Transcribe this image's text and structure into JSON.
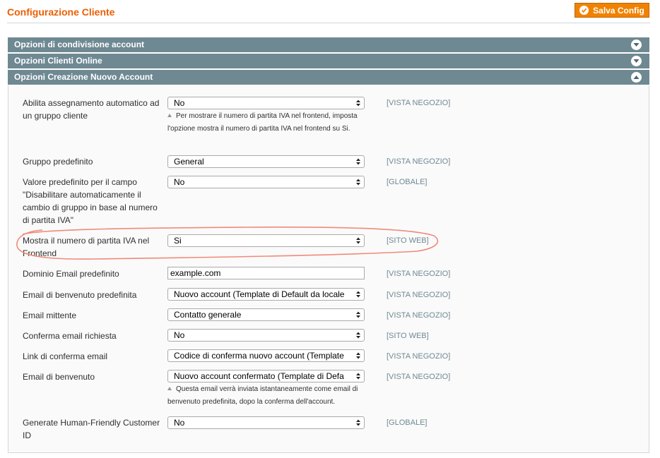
{
  "header": {
    "title": "Configurazione Cliente",
    "save_label": "Salva Config"
  },
  "sections": [
    {
      "label": "Opzioni di condivisione account",
      "state": "collapsed"
    },
    {
      "label": "Opzioni Clienti Online",
      "state": "collapsed"
    },
    {
      "label": "Opzioni Creazione Nuovo Account",
      "state": "expanded"
    }
  ],
  "fields": [
    {
      "label": "Abilita assegnamento automatico ad un gruppo cliente",
      "value": "No",
      "scope": "[VISTA NEGOZIO]",
      "note": "Per mostrare il numero di partita IVA nel frontend, imposta l'opzione mostra il numero di partita IVA nel frontend su Si."
    },
    {
      "label": "Gruppo predefinito",
      "value": "General",
      "scope": "[VISTA NEGOZIO]"
    },
    {
      "label": "Valore predefinito per il campo \"Disabilitare automaticamente il cambio di gruppo in base al numero di partita IVA\"",
      "value": "No",
      "scope": "[GLOBALE]"
    },
    {
      "label": "Mostra il numero di partita IVA nel Frontend",
      "value": "Si",
      "scope": "[SITO WEB]"
    },
    {
      "label": "Dominio Email predefinito",
      "value": "example.com",
      "scope": "[VISTA NEGOZIO]"
    },
    {
      "label": "Email di benvenuto predefinita",
      "value": "Nuovo account (Template di Default da locale",
      "scope": "[VISTA NEGOZIO]"
    },
    {
      "label": "Email mittente",
      "value": "Contatto generale",
      "scope": "[VISTA NEGOZIO]"
    },
    {
      "label": "Conferma email richiesta",
      "value": "No",
      "scope": "[SITO WEB]"
    },
    {
      "label": "Link di conferma email",
      "value": "Codice di conferma nuovo account (Template",
      "scope": "[VISTA NEGOZIO]"
    },
    {
      "label": "Email di benvenuto",
      "value": "Nuovo account confermato (Template di Defa",
      "scope": "[VISTA NEGOZIO]",
      "note": "Questa email verrà inviata istantaneamente come email di benvenuto predefinita, dopo la conferma dell'account."
    },
    {
      "label": "Generate Human-Friendly Customer ID",
      "value": "No",
      "scope": "[GLOBALE]"
    }
  ],
  "colors": {
    "accent": "#eb5e00",
    "section_header": "#6f8992",
    "annotation_stroke": "#f08a7a"
  },
  "icons": {
    "save": "check-circle-icon",
    "collapsed": "chevron-down-icon",
    "expanded": "chevron-up-icon",
    "select": "updown-arrows-icon"
  }
}
